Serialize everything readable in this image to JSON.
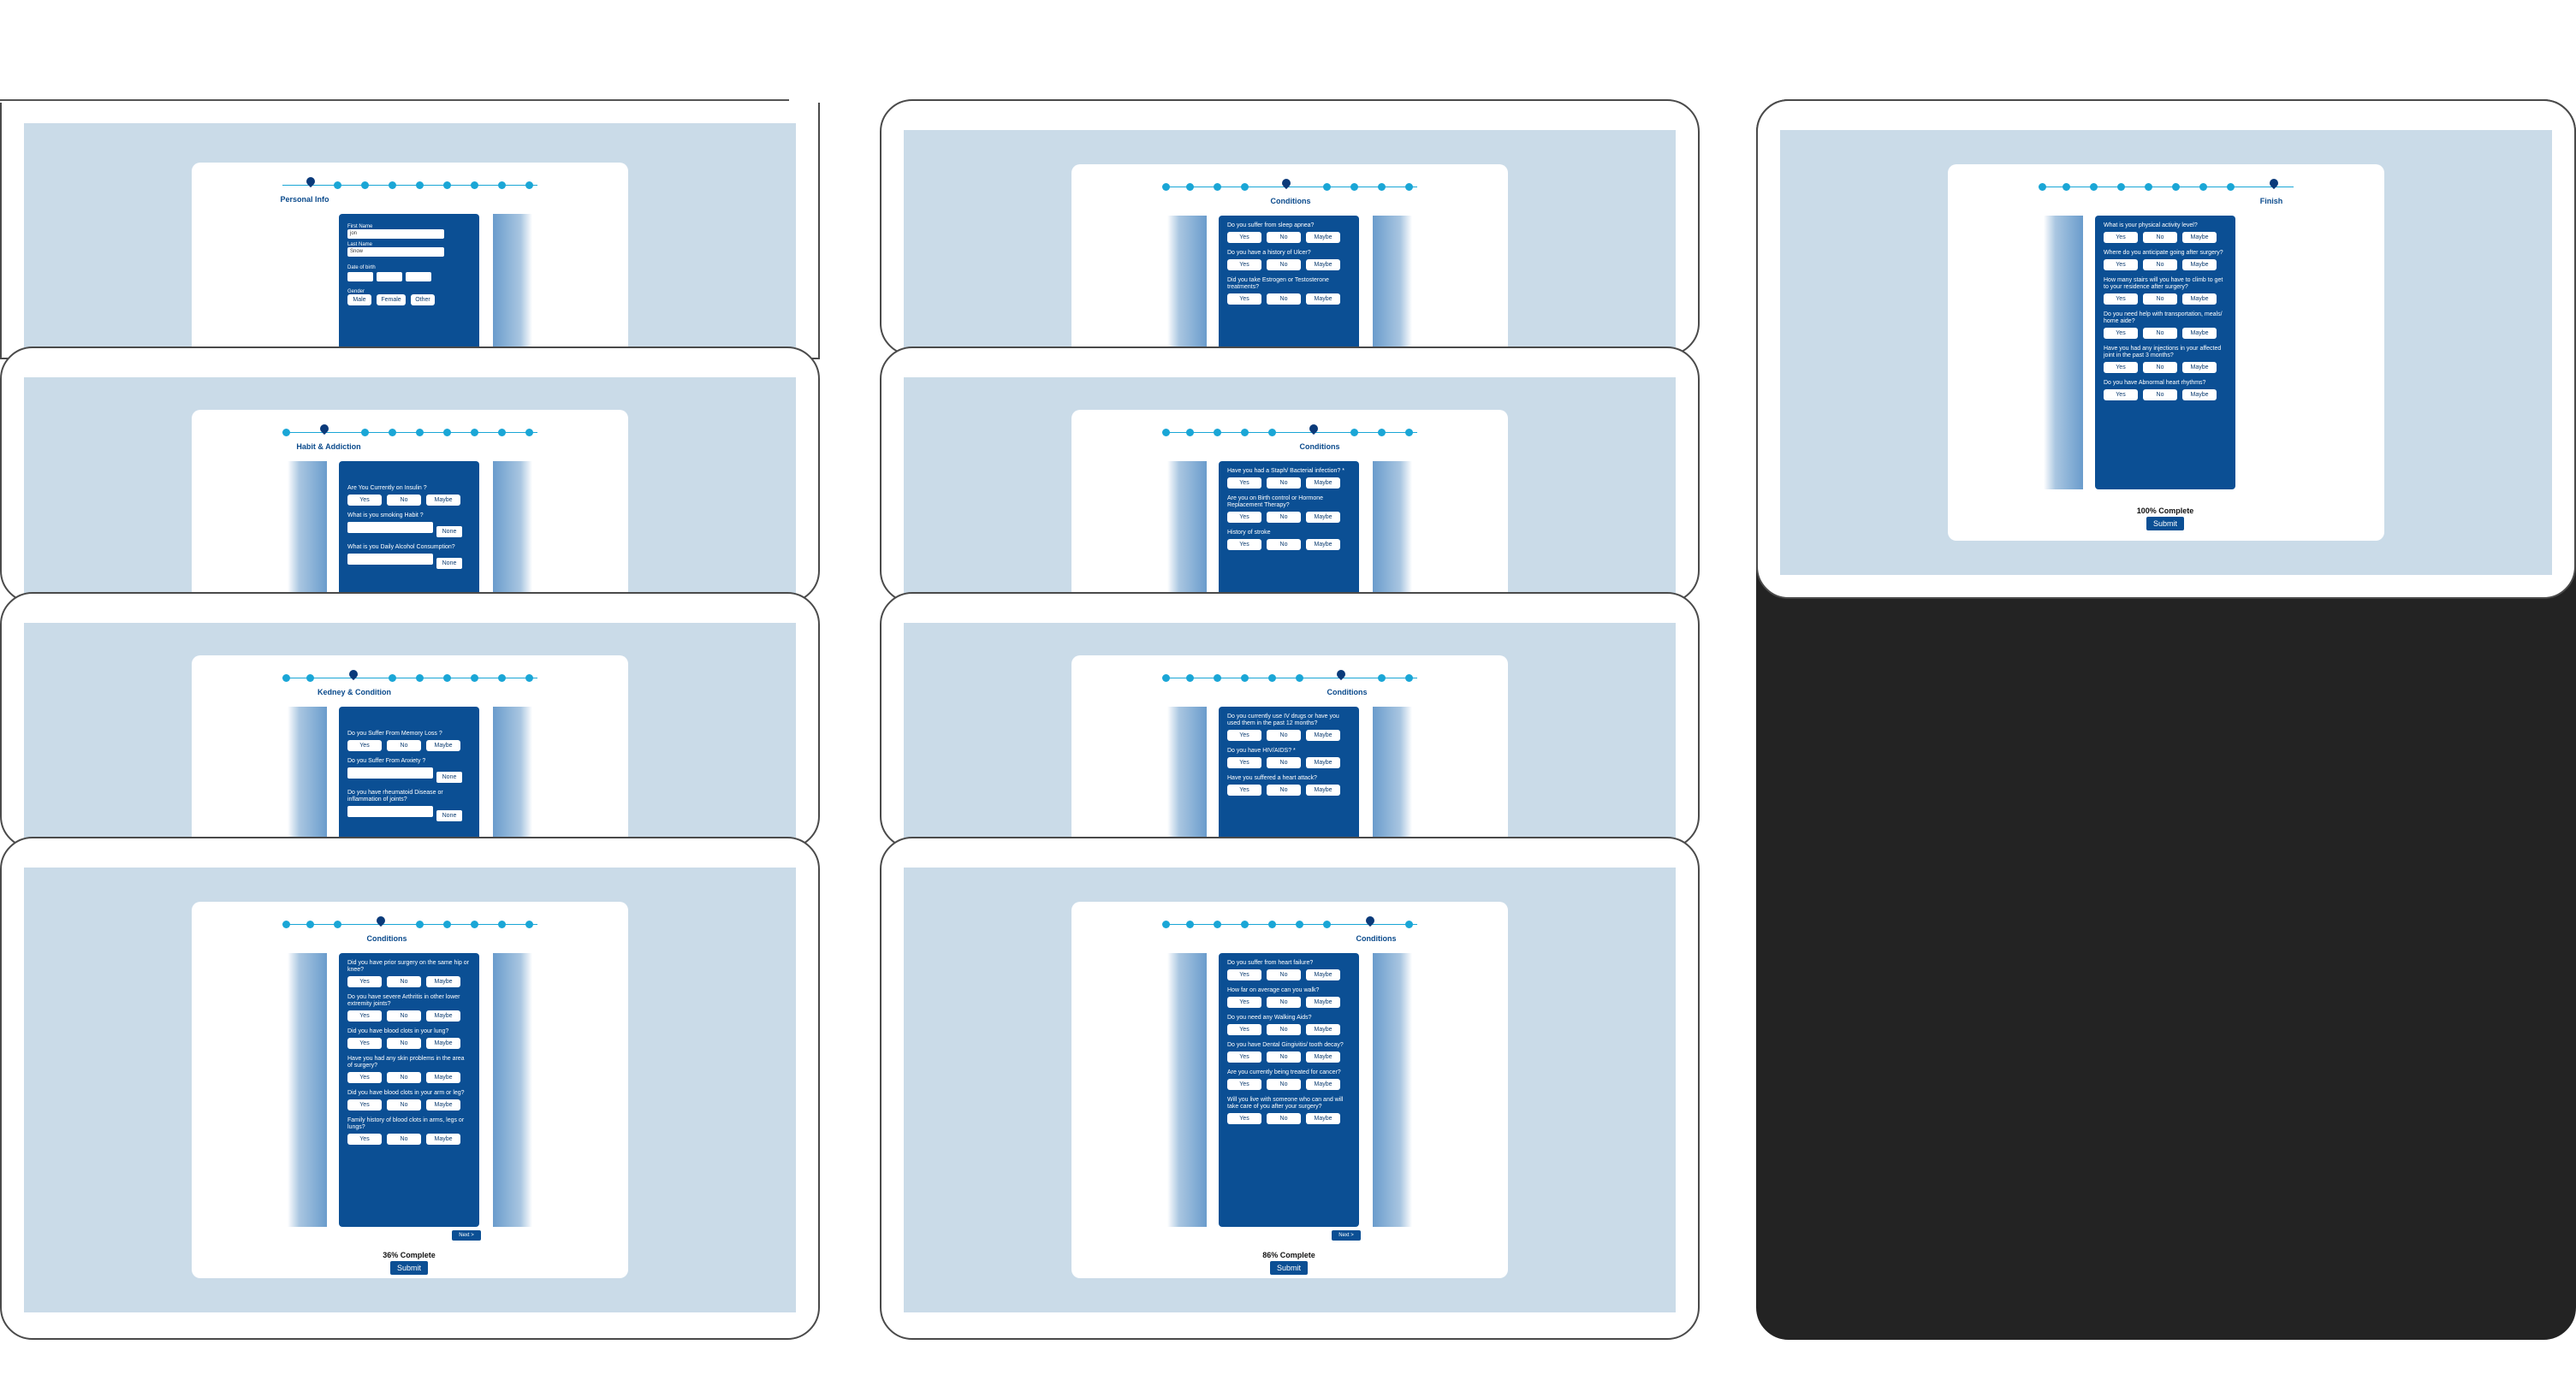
{
  "screens": {
    "personal": {
      "section": "Personal Info",
      "first_name_label": "First Name",
      "first_name_value": "jon",
      "last_name_label": "Last Name",
      "last_name_value": "Snow",
      "dob_label": "Date of birth",
      "gender_label": "Gender",
      "gender_options": [
        "Male",
        "Female",
        "Other"
      ]
    },
    "habit": {
      "section": "Habit & Addiction",
      "questions": [
        "Are You Currently on Insulin ?",
        "What is you smoking Habit ?",
        "What is you Daily Alcohol Consumption?"
      ],
      "none_label": "None"
    },
    "kidney": {
      "section": "Kedney & Condition",
      "questions": [
        "Do you Suffer From Memory Loss ?",
        "Do you Suffer From Anxiety ?",
        "Do you have rheumatoid Disease or inflammation of joints?"
      ]
    },
    "conditions36": {
      "section": "Conditions",
      "questions": [
        "Did you have prior surgery on the same hip or knee?",
        "Do you have severe Arthritis in other lower extremity joints?",
        "Did you have blood clots in your lung?",
        "Have you had any skin problems in the area of surgery?",
        "Did you have blood clots in your arm or leg?",
        "Family history of blood clots in arms, legs or lungs?"
      ],
      "progress": "36% Complete",
      "submit": "Submit",
      "next": "Next >"
    },
    "conditionsA": {
      "section": "Conditions",
      "questions": [
        "Do you suffer from sleep apnea?",
        "Do you have a history of Ulcer?",
        "Did you take Estrogen or Testosterone treatments?"
      ]
    },
    "conditionsB": {
      "section": "Conditions",
      "questions": [
        "Have you had a Staph/ Bacterial infection? *",
        "Are you on Birth control or Hormone Replacement Therapy?",
        "History of stroke"
      ]
    },
    "conditionsC": {
      "section": "Conditions",
      "questions": [
        "Do you currently use IV drugs or have you used them in the past 12 months?",
        "Do you have HIV/AIDS? *",
        "Have you suffered a heart attack?"
      ]
    },
    "conditions86": {
      "section": "Conditions",
      "questions": [
        "Do you suffer from heart failure?",
        "How far on average can you walk?",
        "Do you need any Walking Aids?",
        "Do you have Dental Gingivitis/ tooth decay?",
        "Are you currently being treated for cancer?",
        "Will you live with someone who can and will take care of you after your surgery?"
      ],
      "progress": "86% Complete",
      "submit": "Submit",
      "next": "Next >"
    },
    "finish": {
      "section": "Finish",
      "questions": [
        "What is your physical activity level?",
        "Where do you anticipate going after surgery?",
        "How many stairs will you have to climb to get to your residence after surgery?",
        "Do you need help with transportation, meals/ home aide?",
        "Have you had any injections in your affected joint in the past 3 months?",
        "Do you have Abnormal heart rhythms?"
      ],
      "progress": "100% Complete",
      "submit": "Submit"
    }
  },
  "option_labels": {
    "yes": "Yes",
    "no": "No",
    "maybe": "Maybe"
  },
  "colors": {
    "panel": "#0b4f94",
    "screen_bg": "#cadbe8",
    "stepper": "#1aa6d6",
    "dark_frame": "#232323"
  }
}
